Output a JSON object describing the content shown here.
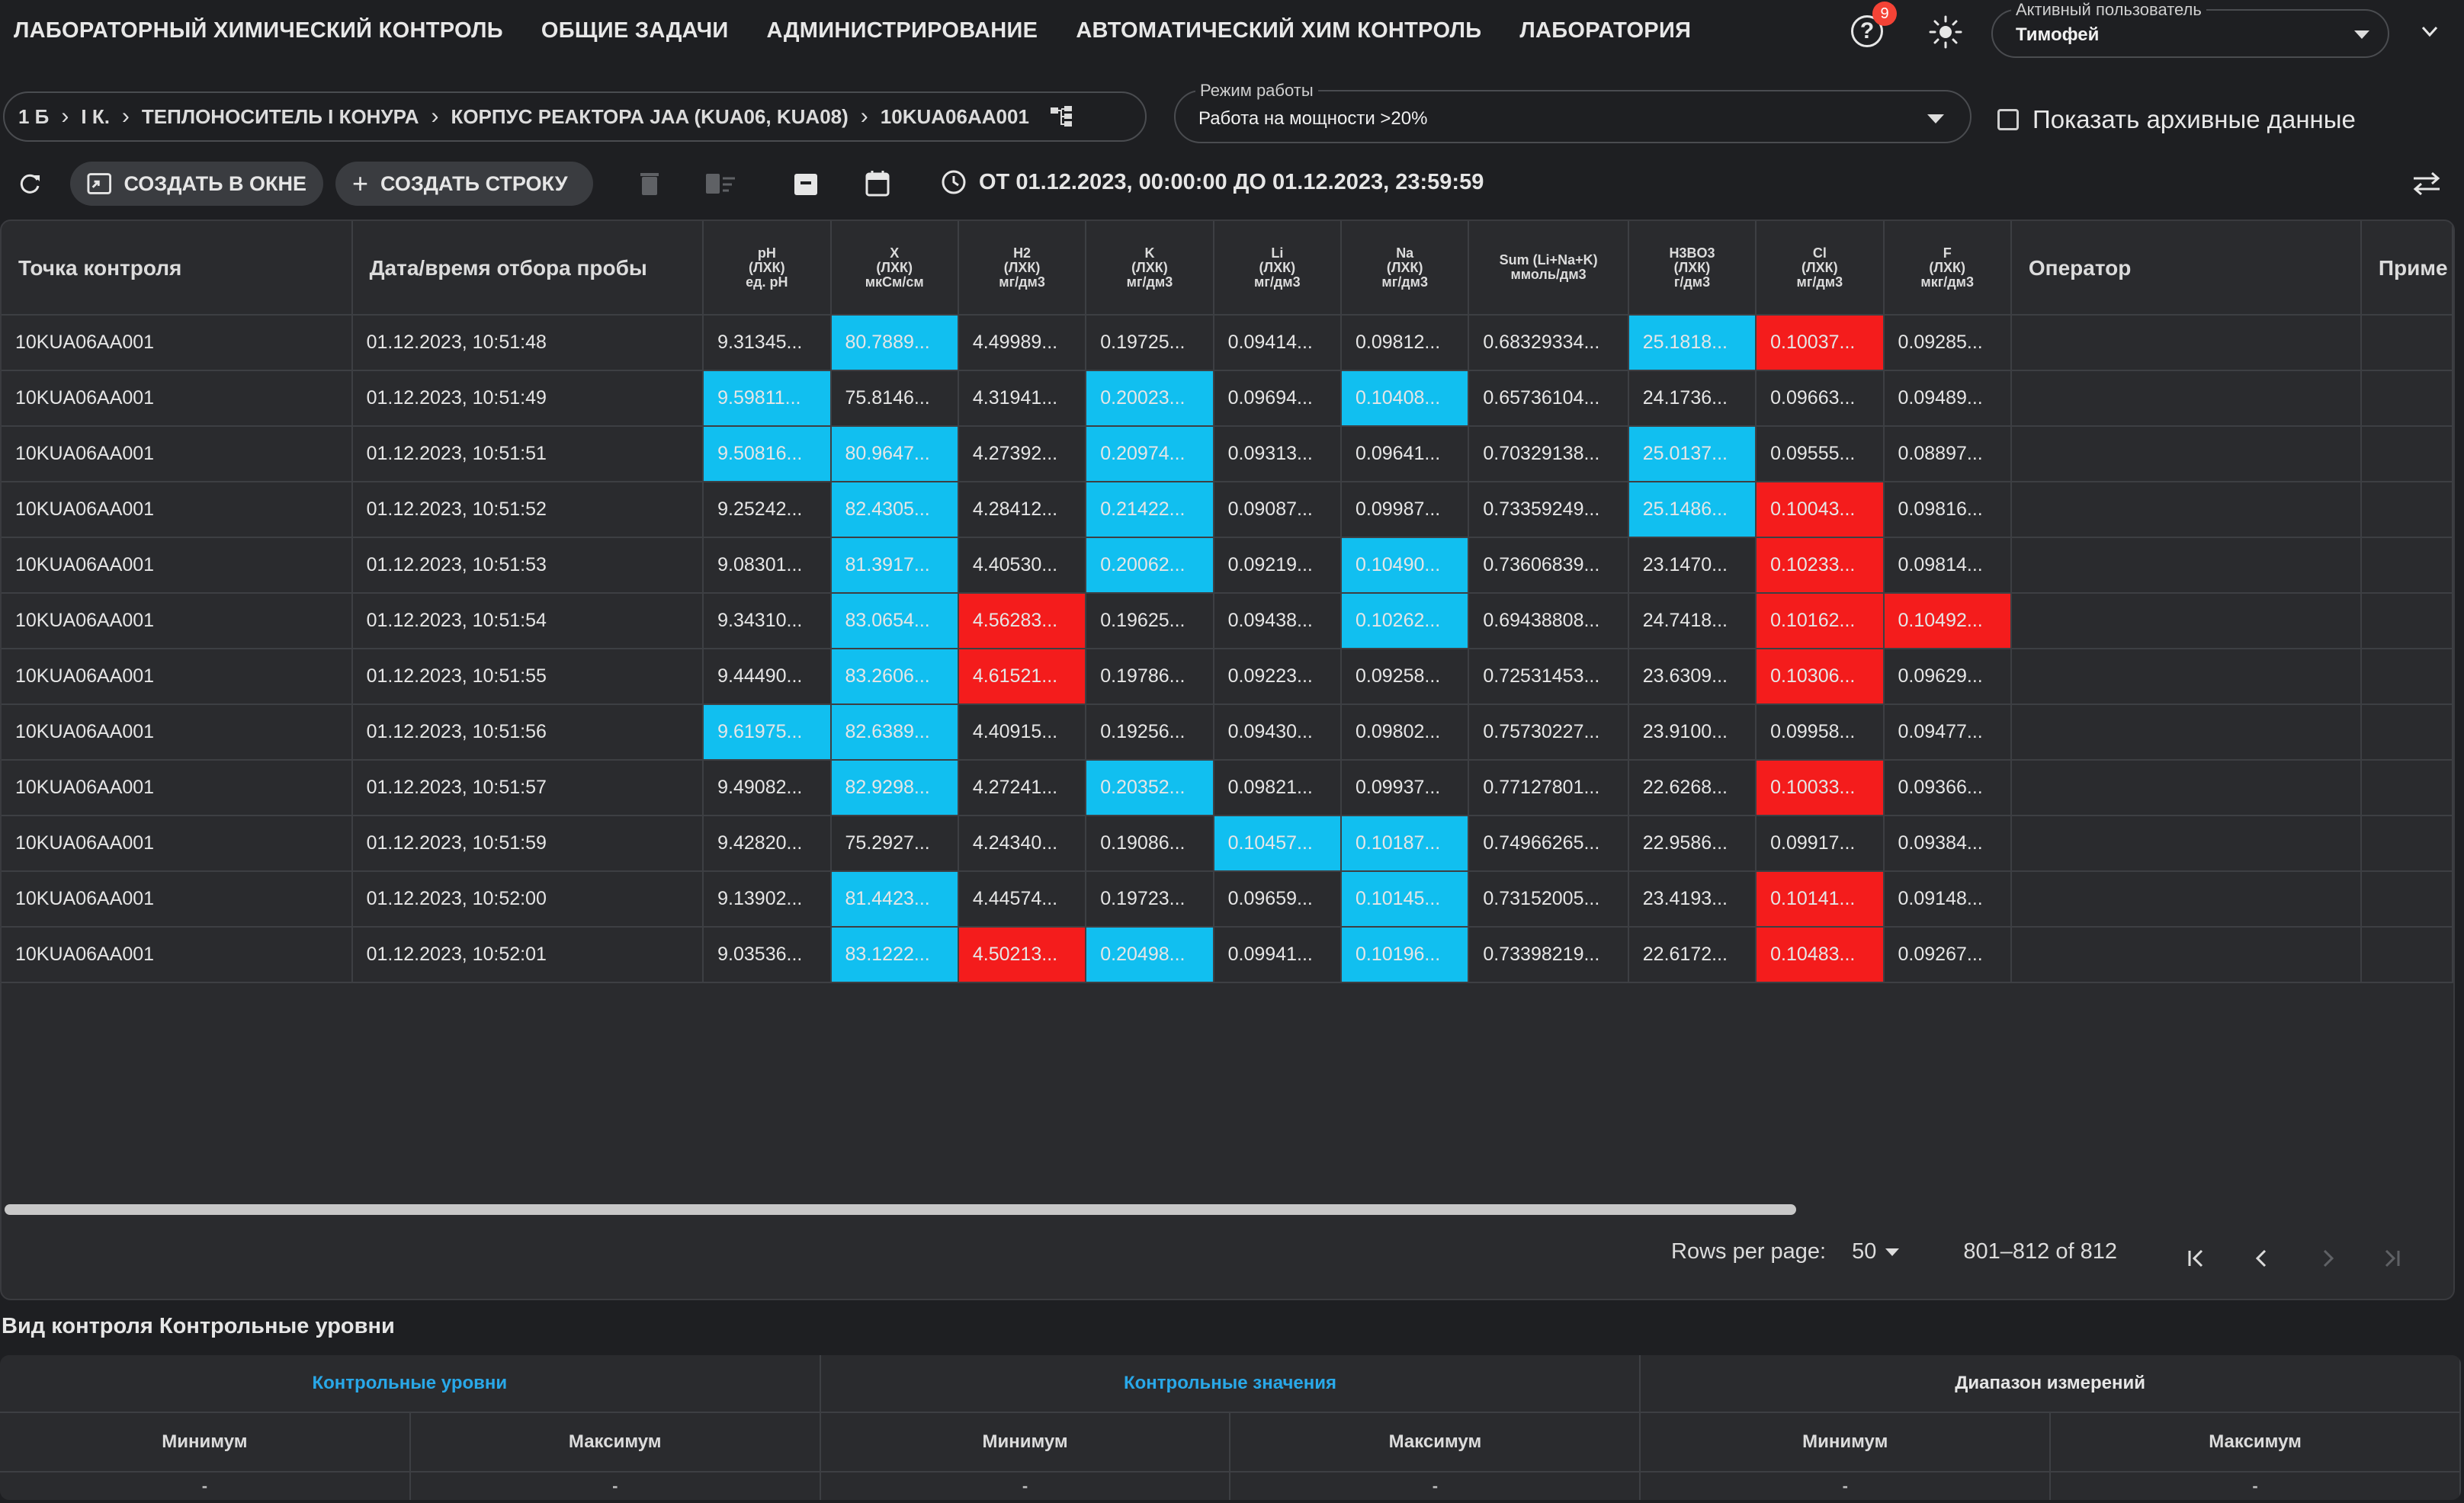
{
  "nav": {
    "items": [
      "ЛАБОРАТОРНЫЙ ХИМИЧЕСКИЙ КОНТРОЛЬ",
      "ОБЩИЕ ЗАДАЧИ",
      "АДМИНИСТРИРОВАНИЕ",
      "АВТОМАТИЧЕСКИЙ ХИМ КОНТРОЛЬ",
      "ЛАБОРАТОРИЯ"
    ],
    "help_badge": "9",
    "help_icon": "?",
    "user_label": "Активный пользователь",
    "user_value": "Тимофей"
  },
  "breadcrumb": [
    "1 Б",
    "I К.",
    "ТЕПЛОНОСИТЕЛЬ I КОНУРА",
    "КОРПУС РЕАКТОРА JAA (KUA06, KUA08)",
    "10KUA06AA001"
  ],
  "mode": {
    "label": "Режим работы",
    "value": "Работа на мощности >20%"
  },
  "archive_label": "Показать архивные данные",
  "toolbar": {
    "create_window": "СОЗДАТЬ В ОКНЕ",
    "create_row": "СОЗДАТЬ СТРОКУ",
    "date_range": "ОТ 01.12.2023, 00:00:00 ДО 01.12.2023, 23:59:59"
  },
  "table": {
    "headers": {
      "point": "Точка контроля",
      "datetime": "Дата/время отбора пробы",
      "ph": [
        "pH",
        "(ЛХК)",
        "ед. pH"
      ],
      "x": [
        "X",
        "(ЛХК)",
        "мкСм/см"
      ],
      "h2": [
        "H2",
        "(ЛХК)",
        "мг/дм3"
      ],
      "k": [
        "K",
        "(ЛХК)",
        "мг/дм3"
      ],
      "li": [
        "Li",
        "(ЛХК)",
        "мг/дм3"
      ],
      "na": [
        "Na",
        "(ЛХК)",
        "мг/дм3"
      ],
      "sum": [
        "Sum (Li+Na+K)",
        "ммоль/дм3"
      ],
      "h3bo3": [
        "H3BO3",
        "(ЛХК)",
        "г/дм3"
      ],
      "cl": [
        "Cl",
        "(ЛХК)",
        "мг/дм3"
      ],
      "f": [
        "F",
        "(ЛХК)",
        "мкг/дм3"
      ],
      "operator": "Оператор",
      "note": "Приме"
    },
    "rows": [
      [
        "10KUA06AA001",
        "01.12.2023, 10:51:48",
        "9.31345...",
        "80.7889...",
        "4.49989...",
        "0.19725...",
        "0.09414...",
        "0.09812...",
        "0.68329334...",
        "25.1818...",
        "0.10037...",
        "0.09285..."
      ],
      [
        "10KUA06AA001",
        "01.12.2023, 10:51:49",
        "9.59811...",
        "75.8146...",
        "4.31941...",
        "0.20023...",
        "0.09694...",
        "0.10408...",
        "0.65736104...",
        "24.1736...",
        "0.09663...",
        "0.09489..."
      ],
      [
        "10KUA06AA001",
        "01.12.2023, 10:51:51",
        "9.50816...",
        "80.9647...",
        "4.27392...",
        "0.20974...",
        "0.09313...",
        "0.09641...",
        "0.70329138...",
        "25.0137...",
        "0.09555...",
        "0.08897..."
      ],
      [
        "10KUA06AA001",
        "01.12.2023, 10:51:52",
        "9.25242...",
        "82.4305...",
        "4.28412...",
        "0.21422...",
        "0.09087...",
        "0.09987...",
        "0.73359249...",
        "25.1486...",
        "0.10043...",
        "0.09816..."
      ],
      [
        "10KUA06AA001",
        "01.12.2023, 10:51:53",
        "9.08301...",
        "81.3917...",
        "4.40530...",
        "0.20062...",
        "0.09219...",
        "0.10490...",
        "0.73606839...",
        "23.1470...",
        "0.10233...",
        "0.09814..."
      ],
      [
        "10KUA06AA001",
        "01.12.2023, 10:51:54",
        "9.34310...",
        "83.0654...",
        "4.56283...",
        "0.19625...",
        "0.09438...",
        "0.10262...",
        "0.69438808...",
        "24.7418...",
        "0.10162...",
        "0.10492..."
      ],
      [
        "10KUA06AA001",
        "01.12.2023, 10:51:55",
        "9.44490...",
        "83.2606...",
        "4.61521...",
        "0.19786...",
        "0.09223...",
        "0.09258...",
        "0.72531453...",
        "23.6309...",
        "0.10306...",
        "0.09629..."
      ],
      [
        "10KUA06AA001",
        "01.12.2023, 10:51:56",
        "9.61975...",
        "82.6389...",
        "4.40915...",
        "0.19256...",
        "0.09430...",
        "0.09802...",
        "0.75730227...",
        "23.9100...",
        "0.09958...",
        "0.09477..."
      ],
      [
        "10KUA06AA001",
        "01.12.2023, 10:51:57",
        "9.49082...",
        "82.9298...",
        "4.27241...",
        "0.20352...",
        "0.09821...",
        "0.09937...",
        "0.77127801...",
        "22.6268...",
        "0.10033...",
        "0.09366..."
      ],
      [
        "10KUA06AA001",
        "01.12.2023, 10:51:59",
        "9.42820...",
        "75.2927...",
        "4.24340...",
        "0.19086...",
        "0.10457...",
        "0.10187...",
        "0.74966265...",
        "22.9586...",
        "0.09917...",
        "0.09384..."
      ],
      [
        "10KUA06AA001",
        "01.12.2023, 10:52:00",
        "9.13902...",
        "81.4423...",
        "4.44574...",
        "0.19723...",
        "0.09659...",
        "0.10145...",
        "0.73152005...",
        "23.4193...",
        "0.10141...",
        "0.09148..."
      ],
      [
        "10KUA06AA001",
        "01.12.2023, 10:52:01",
        "9.03536...",
        "83.1222...",
        "4.50213...",
        "0.20498...",
        "0.09941...",
        "0.10196...",
        "0.73398219...",
        "22.6172...",
        "0.10483...",
        "0.09267..."
      ]
    ],
    "highlights": [
      [
        "",
        "",
        "",
        "blue",
        "",
        "",
        "",
        "",
        "",
        "blue",
        "red",
        ""
      ],
      [
        "",
        "",
        "blue",
        "",
        "",
        "blue",
        "",
        "blue",
        "",
        "",
        "",
        ""
      ],
      [
        "",
        "",
        "blue",
        "blue",
        "",
        "blue",
        "",
        "",
        "",
        "blue",
        "",
        ""
      ],
      [
        "",
        "",
        "",
        "blue",
        "",
        "blue",
        "",
        "",
        "",
        "blue",
        "red",
        ""
      ],
      [
        "",
        "",
        "",
        "blue",
        "",
        "blue",
        "",
        "blue",
        "",
        "",
        "red",
        ""
      ],
      [
        "",
        "",
        "",
        "blue",
        "red",
        "",
        "",
        "blue",
        "",
        "",
        "red",
        "red"
      ],
      [
        "",
        "",
        "",
        "blue",
        "red",
        "",
        "",
        "",
        "",
        "",
        "red",
        ""
      ],
      [
        "",
        "",
        "blue",
        "blue",
        "",
        "",
        "",
        "",
        "",
        "",
        "",
        ""
      ],
      [
        "",
        "",
        "",
        "blue",
        "",
        "blue",
        "",
        "",
        "",
        "",
        "red",
        ""
      ],
      [
        "",
        "",
        "",
        "",
        "",
        "",
        "blue",
        "blue",
        "",
        "",
        "",
        ""
      ],
      [
        "",
        "",
        "",
        "blue",
        "",
        "",
        "",
        "blue",
        "",
        "",
        "red",
        ""
      ],
      [
        "",
        "",
        "",
        "blue",
        "red",
        "blue",
        "",
        "blue",
        "",
        "",
        "red",
        ""
      ]
    ]
  },
  "pagination": {
    "rows_per_page_label": "Rows per page:",
    "rows_per_page": "50",
    "range": "801–812 of 812"
  },
  "levels": {
    "title": "Вид контроля Контрольные уровни",
    "groups": [
      "Контрольные уровни",
      "Контрольные значения",
      "Диапазон измерений"
    ],
    "min": "Минимум",
    "max": "Максимум",
    "dash": "-"
  },
  "colors": {
    "accent_blue": "#11bff0",
    "alert_red": "#f41c1c",
    "background": "#1e1f22",
    "panel": "#2a2b2e"
  }
}
